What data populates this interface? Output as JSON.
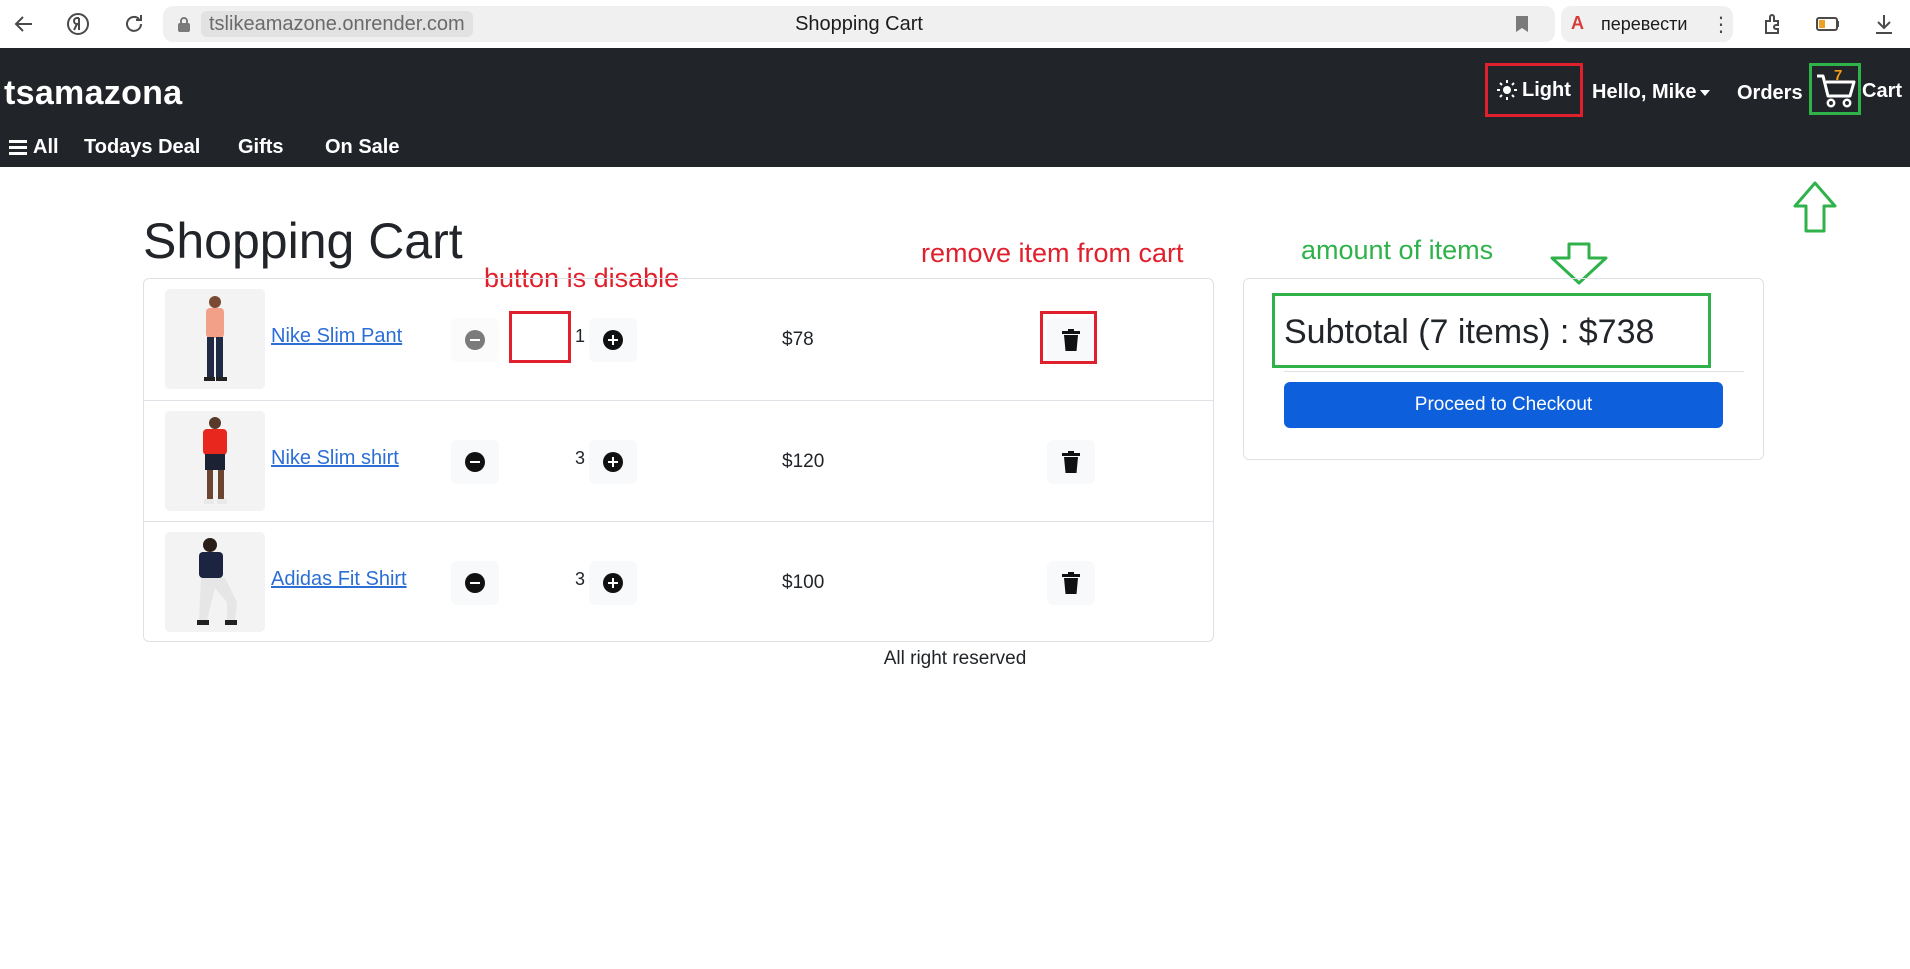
{
  "browser": {
    "url": "tslikeamazone.onrender.com",
    "tab_title": "Shopping Cart",
    "translate_label": "перевести"
  },
  "navbar": {
    "brand": "tsamazona",
    "theme_label": "Light",
    "user_label": "Hello, Mike",
    "orders_label": "Orders",
    "cart_count": "7",
    "cart_label": "Cart",
    "subnav": [
      "All",
      "Todays Deal",
      "Gifts",
      "On Sale"
    ]
  },
  "main": {
    "title": "Shopping Cart",
    "items": [
      {
        "name": "Nike Slim Pant",
        "quantity": "1",
        "price": "$78",
        "decrease_disabled": true,
        "shirt_color": "#f2a088",
        "pants_color": "#1f2a44"
      },
      {
        "name": "Nike Slim shirt",
        "quantity": "3",
        "price": "$120",
        "decrease_disabled": false,
        "shirt_color": "#e8281e",
        "pants_color": "#1b2233"
      },
      {
        "name": "Adidas Fit Shirt",
        "quantity": "3",
        "price": "$100",
        "decrease_disabled": false,
        "shirt_color": "#1b2440",
        "pants_color": "#e6e6e6"
      }
    ],
    "summary": {
      "subtotal": "Subtotal (7 items) : $738",
      "checkout_label": "Proceed to Checkout"
    },
    "footer": "All right reserved"
  },
  "annotations": {
    "button_disabled": "button is disable",
    "remove_item": "remove item from cart",
    "amount_items": "amount of items",
    "red_color": "#e0202c",
    "green_color": "#2fb24a"
  },
  "icons": {
    "theme": "sun-icon",
    "cart": "cart-icon",
    "delete": "trash-icon",
    "decrease": "minus-circle-icon",
    "increase": "plus-circle-icon",
    "menu": "hamburger-icon"
  }
}
